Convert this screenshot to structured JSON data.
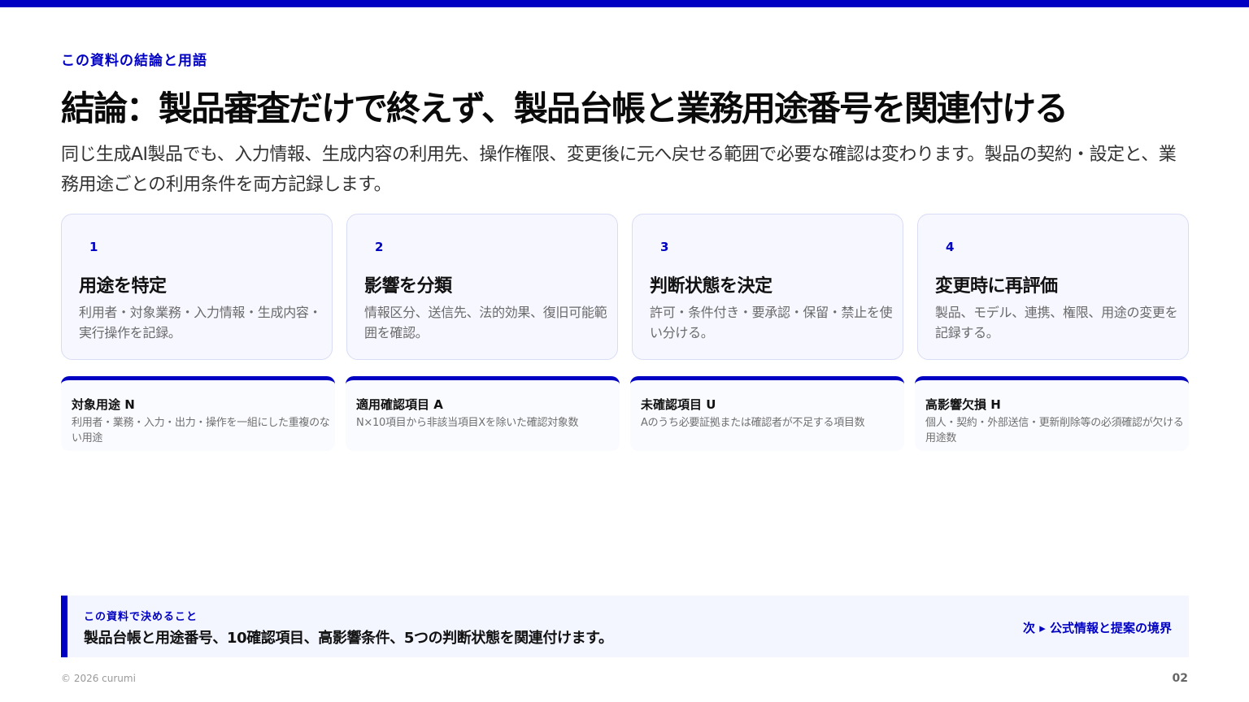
{
  "accent_color": "#0000c2",
  "eyebrow": "この資料の結論と用語",
  "title": "結論：製品審査だけで終えず、製品台帳と業務用途番号を関連付ける",
  "lead": "同じ生成AI製品でも、入力情報、生成内容の利用先、操作権限、変更後に元へ戻せる範囲で必要な確認は変わります。製品の契約・設定と、業務用途ごとの利用条件を両方記録します。",
  "steps": [
    {
      "num": "1",
      "title": "用途を特定",
      "desc": "利用者・対象業務・入力情報・生成内容・実行操作を記録。"
    },
    {
      "num": "2",
      "title": "影響を分類",
      "desc": "情報区分、送信先、法的効果、復旧可能範囲を確認。"
    },
    {
      "num": "3",
      "title": "判断状態を決定",
      "desc": "許可・条件付き・要承認・保留・禁止を使い分ける。"
    },
    {
      "num": "4",
      "title": "変更時に再評価",
      "desc": "製品、モデル、連携、権限、用途の変更を記録する。"
    }
  ],
  "variables": [
    {
      "title": "対象用途 N",
      "desc": "利用者・業務・入力・出力・操作を一組にした重複のない用途"
    },
    {
      "title": "適用確認項目 A",
      "desc": "N×10項目から非該当項目Xを除いた確認対象数"
    },
    {
      "title": "未確認項目 U",
      "desc": "Aのうち必要証拠または確認者が不足する項目数"
    },
    {
      "title": "高影響欠損 H",
      "desc": "個人・契約・外部送信・更新削除等の必須確認が欠ける用途数"
    }
  ],
  "decision": {
    "label": "この資料で決めること",
    "text": "製品台帳と用途番号、10確認項目、高影響条件、5つの判断状態を関連付けます。",
    "next": "次 ▸ 公式情報と提案の境界"
  },
  "footer": {
    "copyright": "© 2026 curumi",
    "page": "02"
  }
}
